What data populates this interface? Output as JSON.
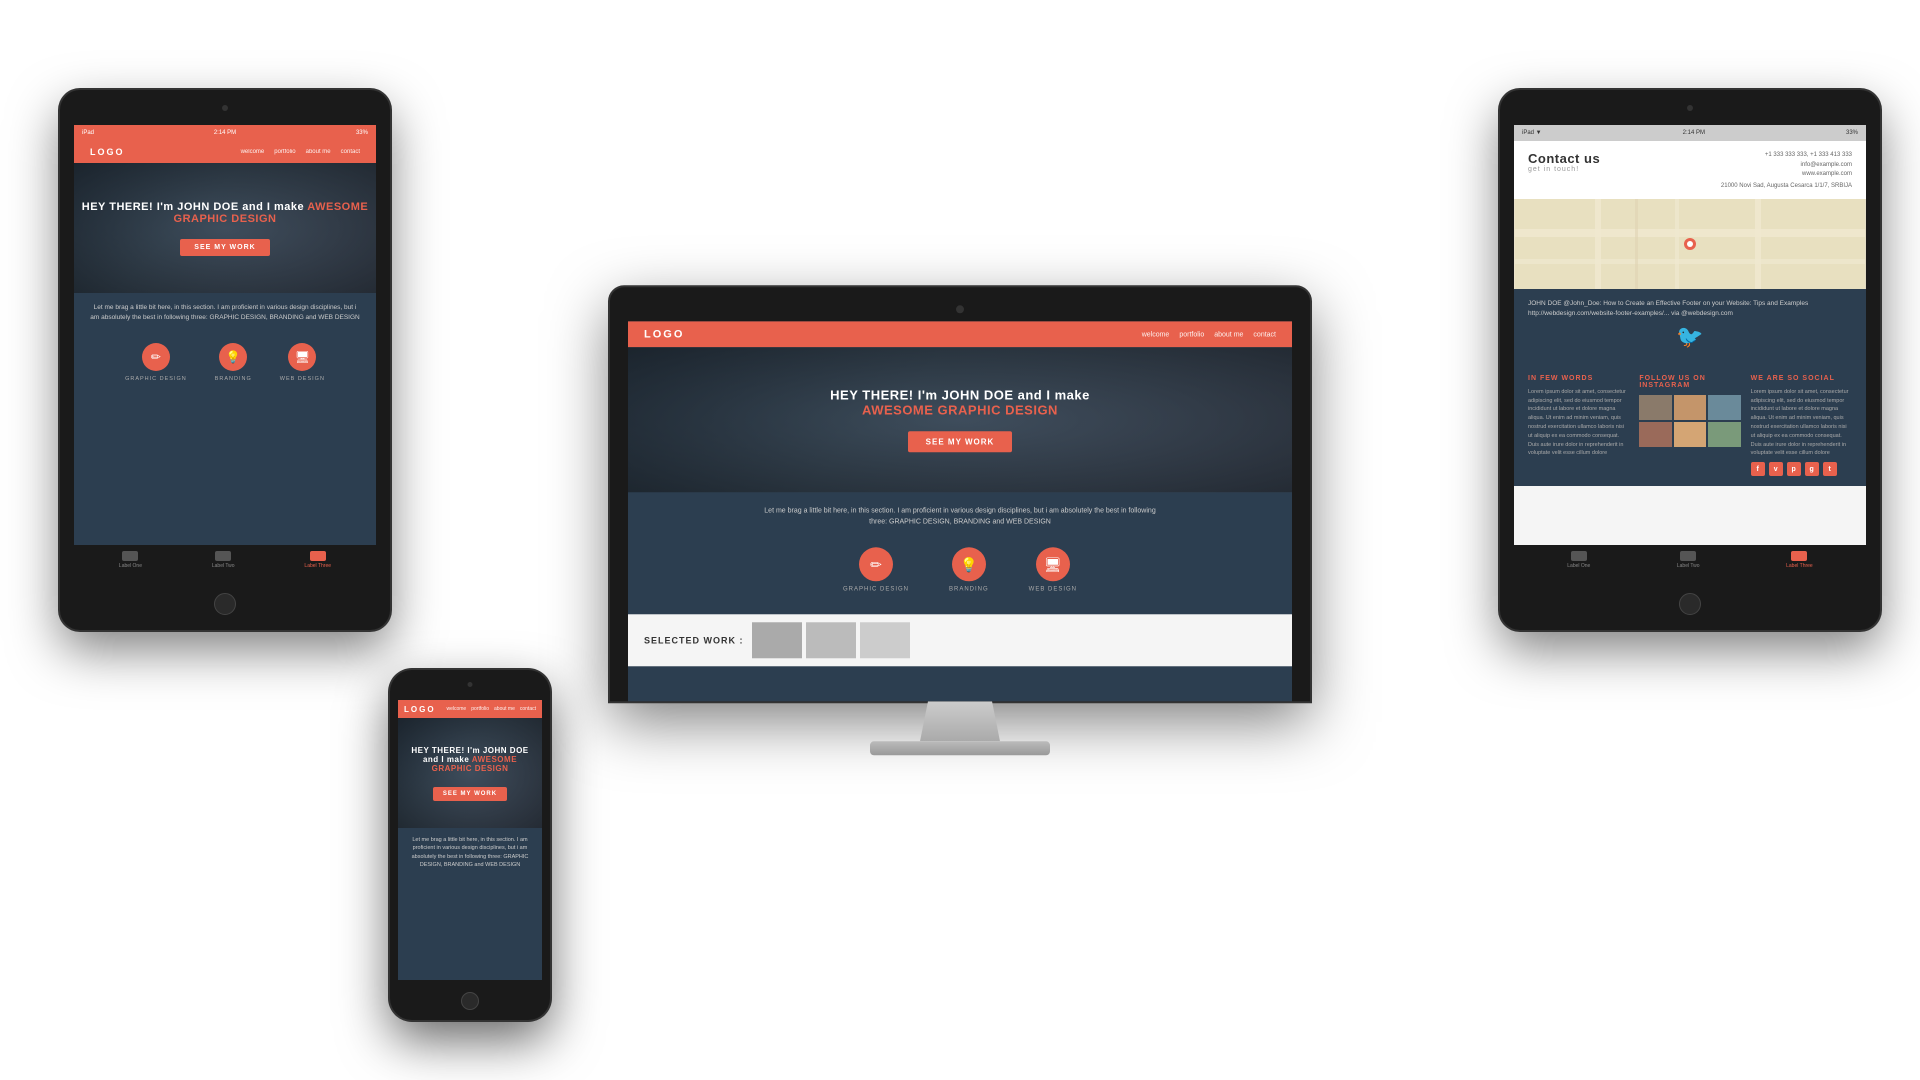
{
  "scene": {
    "background": "#ffffff"
  },
  "monitor": {
    "site": {
      "logo": "LOGO",
      "nav": [
        "welcome",
        "portfolio",
        "about me",
        "contact"
      ],
      "hero_title": "HEY THERE! I'm JOHN DOE and I make",
      "hero_accent": "AWESOME GRAPHIC DESIGN",
      "hero_btn": "SEE MY WORK",
      "about_text": "Let me brag a little bit here, in this section. I am proficient in various design disciplines, but i am absolutely the best in following three: GRAPHIC DESIGN, BRANDING and WEB DESIGN",
      "services": [
        {
          "label": "GRAPHIC DESIGN",
          "icon": "✏"
        },
        {
          "label": "BRANDING",
          "icon": "💡"
        },
        {
          "label": "WEB DESIGN",
          "icon": "🖥"
        }
      ],
      "work_title": "SELECTED WORK :"
    }
  },
  "tablet_left": {
    "status_text": "iPad",
    "time": "2:14 PM",
    "battery": "33%",
    "nav_items": [
      {
        "label": "Label One",
        "active": false
      },
      {
        "label": "Label Two",
        "active": false
      },
      {
        "label": "Label Three",
        "active": true
      }
    ]
  },
  "phone": {
    "header_logo": "LOGO",
    "nav": [
      "welcome",
      "portfolio",
      "about me",
      "contact"
    ],
    "hero_title": "HEY THERE! I'm JOHN DOE and I make",
    "hero_accent": "AWESOME GRAPHIC DESIGN",
    "hero_btn": "SEE MY WORK",
    "about_text": "Let me brag a little bit here, in this section. I am proficient in various design disciplines, but i am absolutely the best in following three: GRAPHIC DESIGN, BRANDING and WEB DESIGN"
  },
  "tablet_right": {
    "contact_title": "Contact us",
    "contact_subtitle": "get in touch!",
    "address": "21000 Novi Sad\nAugusta Cesarca 1/1/7\nSRBIJA",
    "phone": "+1 333 333 333, +1 333 413 333",
    "email": "info@example.com",
    "website": "www.example.com",
    "twitter_text": "JOHN DOE @John_Doe: How to Create an Effective Footer on your Website: Tips and Examples http://webdesign.com/website-footer-examples/... via @webdesign.com",
    "footer": {
      "col1_title": "IN FEW WORDS",
      "col1_text": "Lorem ipsum dolor sit amet, consectetur adipiscing elit, sed do eiusmod tempor incididunt ut labore et dolore magna aliqua. Ut enim ad minim veniam, quis nostrud exercitation ullamco laboris nisi ut aliquip ex ea commodo consequat. Duis aute irure dolor in reprehenderit in voluptate velit esse cillum dolore",
      "col2_title": "FOLLOW US ON INSTAGRAM",
      "col3_title": "WE ARE SO SOCIAL",
      "col3_text": "Lorem ipsum dolor sit amet, consectetur adipiscing elit, sed do eiusmod tempor incididunt ut labore et dolore magna aliqua. Ut enim ad minim veniam, quis nostrud exercitation ullamco laboris nisi ut aliquip ex ea commodo consequat. Duis aute irure dolor in reprehenderit in voluptate velit esse cillum dolore",
      "social_icons": [
        "f",
        "v",
        "p",
        "g+",
        "t"
      ]
    },
    "nav_items": [
      {
        "label": "Label One",
        "active": false
      },
      {
        "label": "Label Two",
        "active": false
      },
      {
        "label": "Label Three",
        "active": true
      }
    ]
  }
}
